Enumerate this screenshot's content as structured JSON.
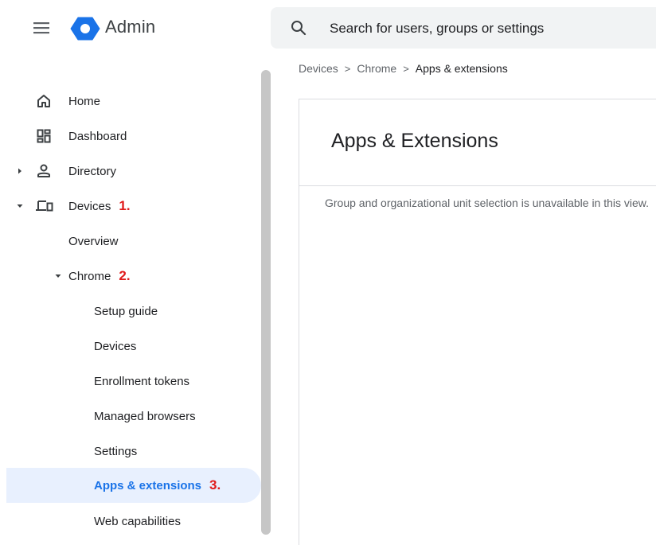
{
  "header": {
    "app_title": "Admin",
    "menu_icon": "hamburger-menu-icon",
    "logo_icon": "google-admin-hexagon-logo",
    "logo_color": "#1a73e8",
    "search": {
      "icon": "search-icon",
      "placeholder": "Search for users, groups or settings",
      "value": ""
    }
  },
  "sidebar": {
    "items": [
      {
        "label": "Home",
        "icon": "home-icon"
      },
      {
        "label": "Dashboard",
        "icon": "dashboard-icon"
      },
      {
        "label": "Directory",
        "icon": "person-icon",
        "expanded": false
      },
      {
        "label": "Devices",
        "icon": "devices-icon",
        "expanded": true,
        "step": "1."
      },
      {
        "label": "Overview"
      },
      {
        "label": "Chrome",
        "expanded": true,
        "step": "2."
      },
      {
        "label": "Setup guide"
      },
      {
        "label": "Devices"
      },
      {
        "label": "Enrollment tokens"
      },
      {
        "label": "Managed browsers"
      },
      {
        "label": "Settings"
      },
      {
        "label": "Apps & extensions",
        "active": true,
        "step": "3."
      },
      {
        "label": "Web capabilities"
      }
    ],
    "active_bg": "#e8f0fe",
    "active_color": "#1a73e8",
    "step_color": "#e01b1b"
  },
  "breadcrumb": {
    "items": [
      "Devices",
      "Chrome",
      "Apps & extensions"
    ],
    "separator": ">"
  },
  "main": {
    "title": "Apps & Extensions",
    "message": "Group and organizational unit selection is unavailable in this view."
  }
}
